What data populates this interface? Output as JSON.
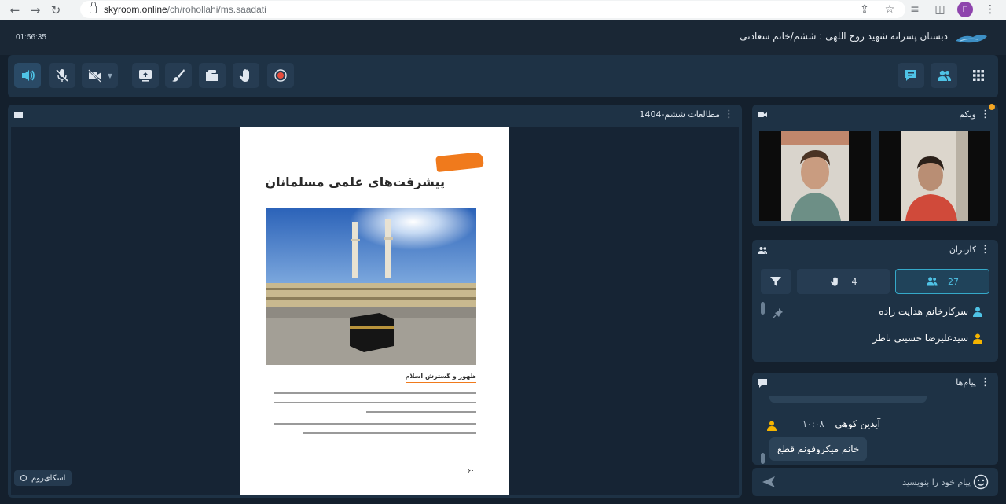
{
  "browser": {
    "url_host": "skyroom.online",
    "url_path": "/ch/rohollahi/ms.saadati",
    "profile_initial": "F"
  },
  "header": {
    "timer": "01:56:35",
    "room_title": "دبستان پسرانه شهید روح اللهی : ششم/خانم سعادتی"
  },
  "presentation": {
    "title": "مطالعات ششم-1404",
    "heading": "پیشرفت‌های علمی مسلمانان",
    "section_heading": "ظهور و گسترش اسلام",
    "page_number": "۶۰",
    "badge": "اسکای‌روم"
  },
  "webcam": {
    "title": "وبکم"
  },
  "users": {
    "title": "کاربران",
    "user_count": "27",
    "hand_count": "4",
    "list": [
      {
        "name": "سرکارخانم هدایت زاده",
        "color": "#4fc3e6"
      },
      {
        "name": "سیدعلیرضا حسینی ناظر",
        "color": "#f5b400"
      }
    ]
  },
  "messages": {
    "title": "پیام‌ها",
    "items": [
      {
        "author": "آیدین کوهی",
        "time": "۱۰:۰۸",
        "text": "خانم میکروفونم قطع"
      }
    ],
    "input_placeholder": "پیام خود را بنویسید"
  },
  "icons": {
    "toolbar": [
      "speaker-icon",
      "mic-off-icon",
      "camera-off-icon",
      "screen-share-icon",
      "brush-icon",
      "folder-icon",
      "hand-icon",
      "record-icon"
    ],
    "header_right": [
      "chat-icon",
      "users-icon",
      "apps-grid-icon"
    ]
  },
  "colors": {
    "accent": "#4fc3e6",
    "record": "#e74c3c",
    "notification": "#f5a623",
    "orange_tag": "#f07a1c"
  }
}
